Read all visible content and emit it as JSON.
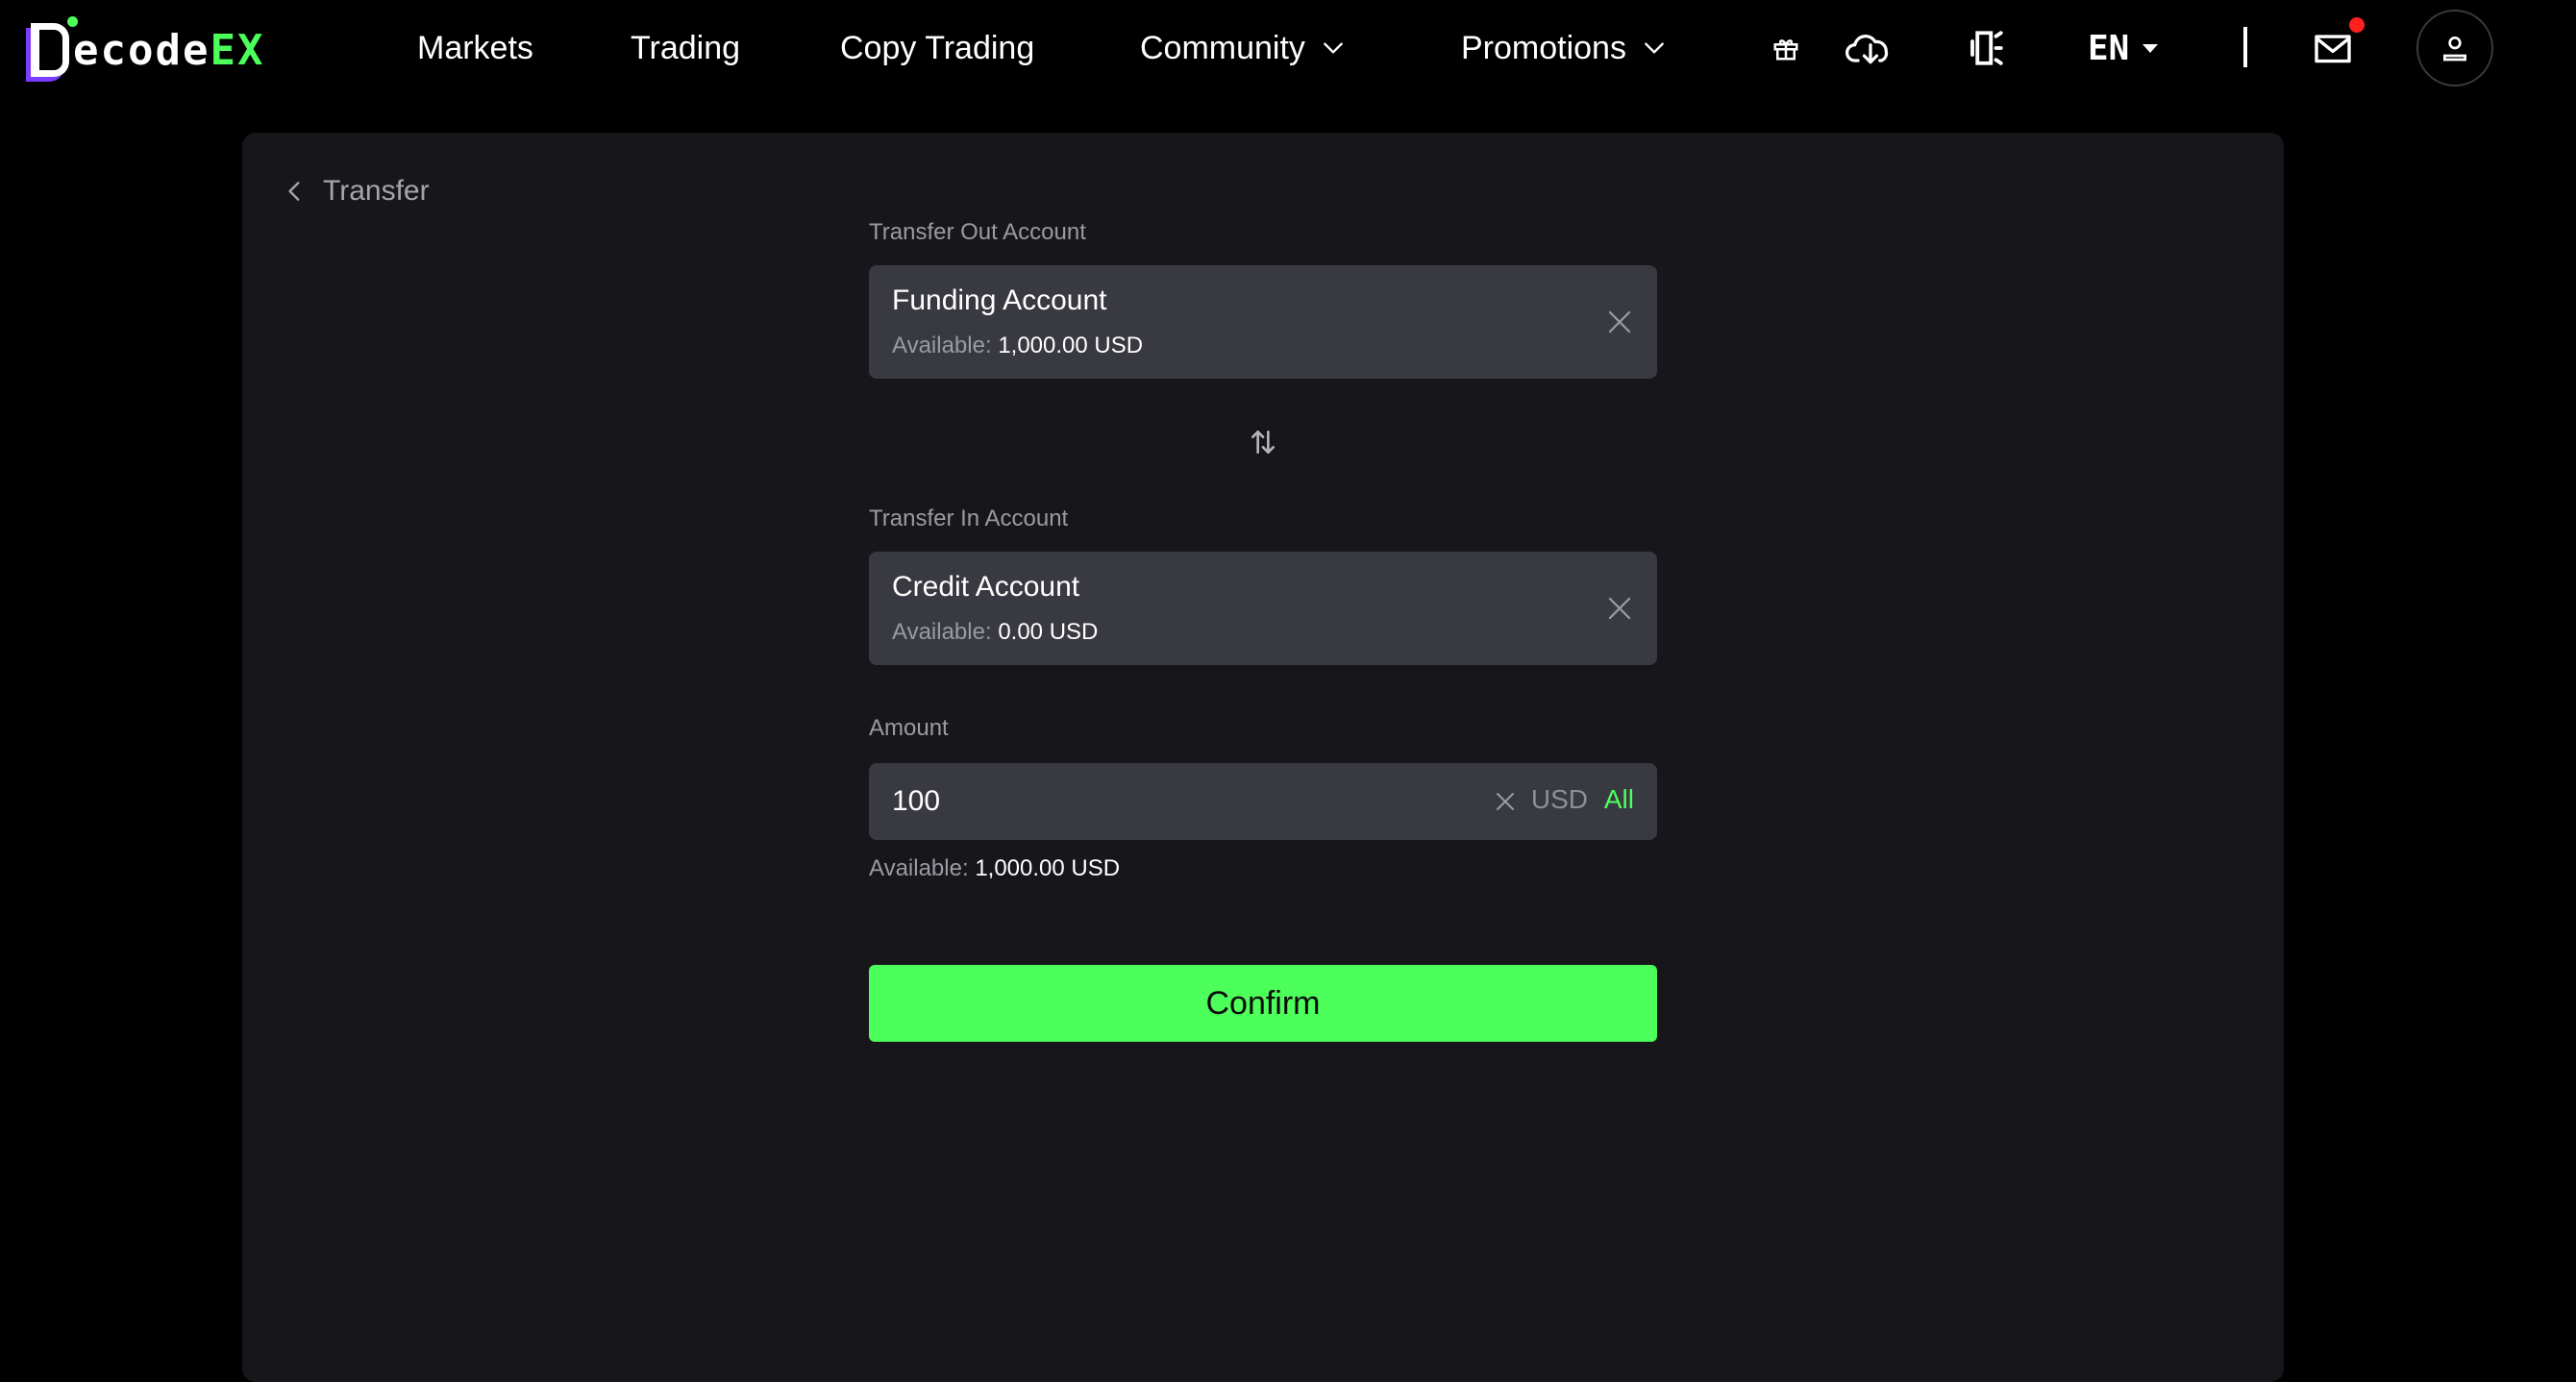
{
  "brand": {
    "logo_text_white": "ecode",
    "logo_text_green": "EX",
    "accent_color": "#4cff5a"
  },
  "nav": {
    "markets": "Markets",
    "trading": "Trading",
    "copy_trading": "Copy Trading",
    "community": "Community",
    "promotions": "Promotions"
  },
  "header": {
    "language": "EN",
    "icons": [
      "gift-icon",
      "cloud-download-icon",
      "mobile-app-icon",
      "mail-icon",
      "user-icon"
    ],
    "has_notification": true
  },
  "page": {
    "back_label": "Transfer"
  },
  "transfer_out": {
    "label": "Transfer Out Account",
    "account_name": "Funding Account",
    "available_label": "Available:",
    "available_value": "1,000.00 USD"
  },
  "transfer_in": {
    "label": "Transfer In Account",
    "account_name": "Credit Account",
    "available_label": "Available:",
    "available_value": "0.00 USD"
  },
  "amount": {
    "label": "Amount",
    "value": "100",
    "unit": "USD",
    "all_label": "All",
    "available_label": "Available:",
    "available_value": "1,000.00 USD"
  },
  "confirm_label": "Confirm"
}
